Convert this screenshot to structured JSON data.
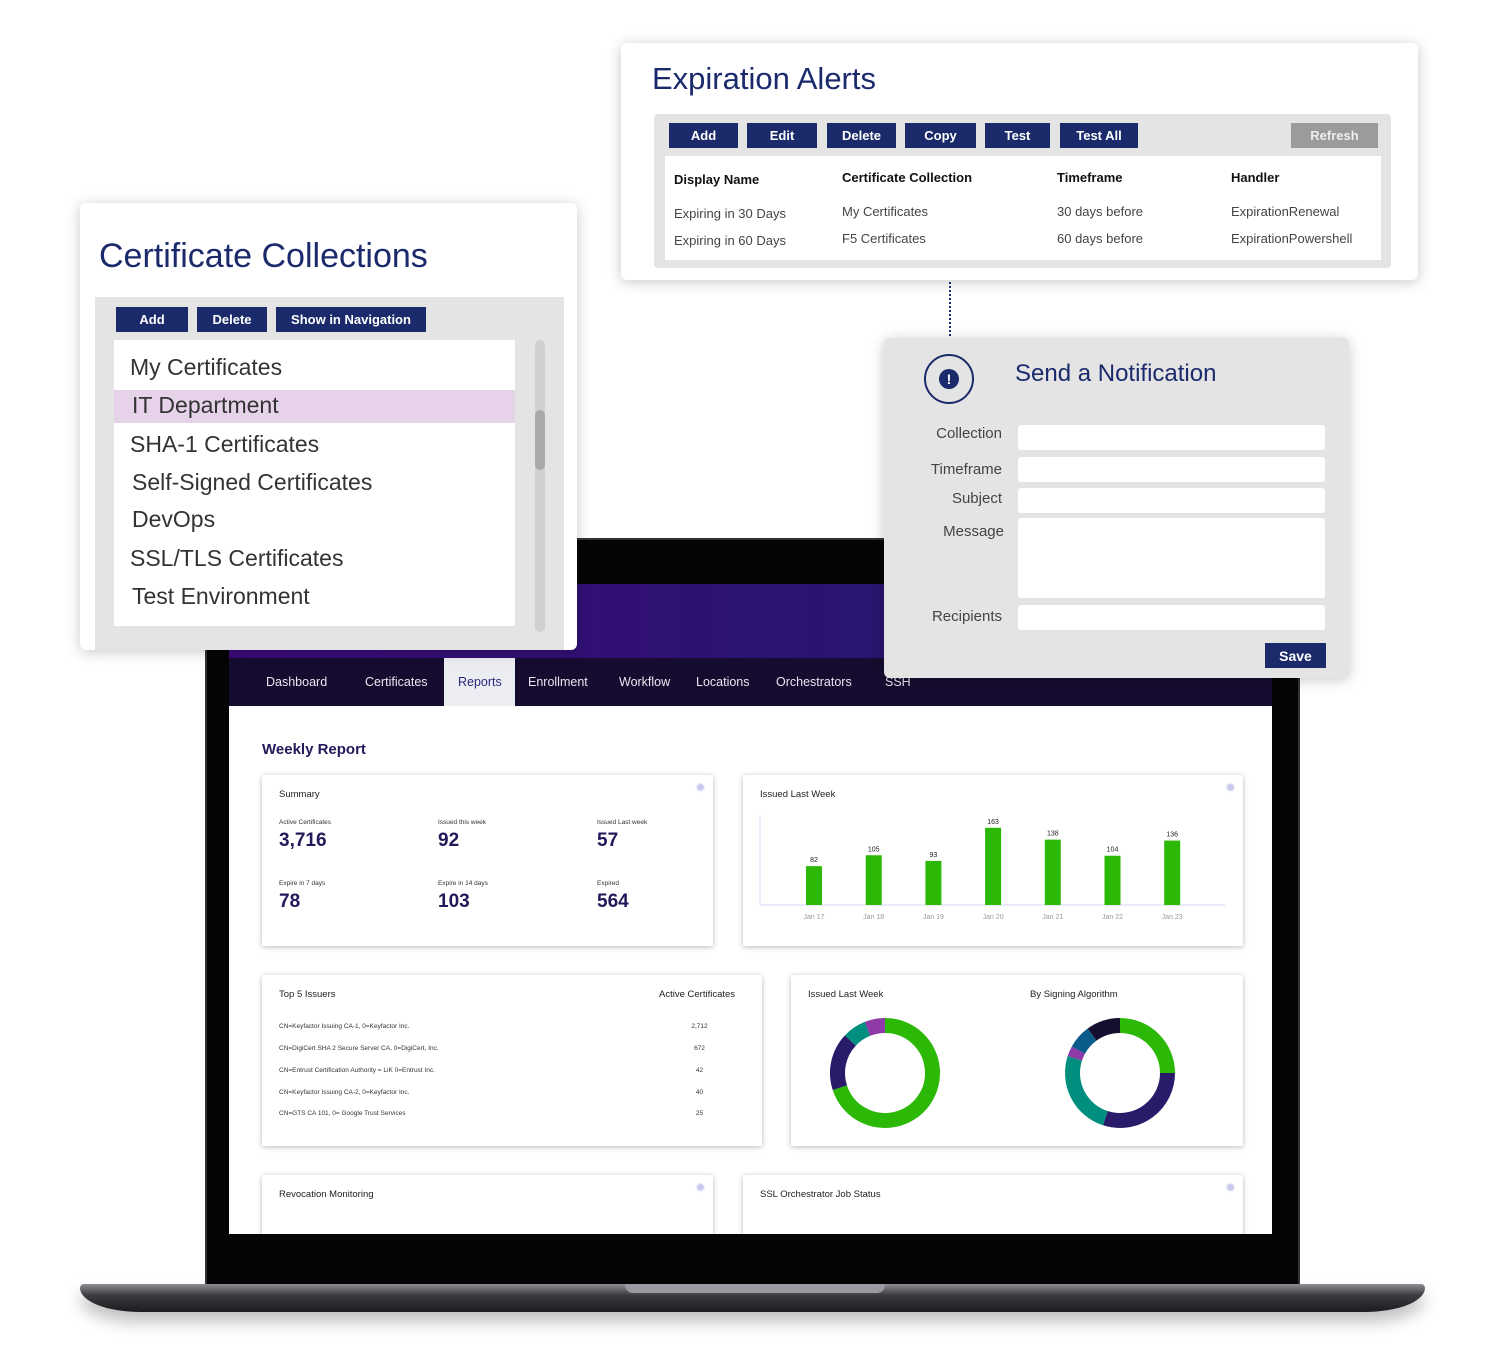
{
  "colors": {
    "navy": "#1b2a6b",
    "green": "#2bb806",
    "highlight": "#e6d3ea",
    "refresh": "#9b9b9b",
    "dark_purple": "#2a1a6a",
    "teal": "#008f7e",
    "magenta": "#8e3aa8",
    "blue": "#0a5c8a",
    "black": "#151030"
  },
  "collections": {
    "title": "Certificate Collections",
    "buttons": [
      "Add",
      "Delete",
      "Show in Navigation"
    ],
    "items": [
      "My Certificates",
      "IT Department",
      "SHA-1 Certificates",
      "Self-Signed Certificates",
      "DevOps",
      "SSL/TLS Certificates",
      "Test Environment"
    ],
    "selected": "IT Department"
  },
  "alerts": {
    "title": "Expiration Alerts",
    "buttons": [
      "Add",
      "Edit",
      "Delete",
      "Copy",
      "Test",
      "Test All"
    ],
    "refresh": "Refresh",
    "columns": [
      "Display Name",
      "Certificate Collection",
      "Timeframe",
      "Handler"
    ],
    "rows": [
      [
        "Expiring in 30 Days",
        "My Certificates",
        "30 days before",
        "ExpirationRenewal"
      ],
      [
        "Expiring in 60 Days",
        "F5 Certificates",
        "60 days before",
        "ExpirationPowershell"
      ]
    ]
  },
  "notification": {
    "icon": "alert-icon",
    "title": "Send a Notification",
    "fields": [
      "Collection",
      "Timeframe",
      "Subject",
      "Message",
      "Recipients"
    ],
    "save": "Save"
  },
  "nav": {
    "items": [
      "Dashboard",
      "Certificates",
      "Reports",
      "Enrollment",
      "Workflow",
      "Locations",
      "Orchestrators",
      "SSH"
    ],
    "active": "Reports"
  },
  "report": {
    "title": "Weekly Report",
    "summary": {
      "title": "Summary",
      "stats": [
        {
          "label": "Active Certificates",
          "value": "3,716"
        },
        {
          "label": "Issued this week",
          "value": "92"
        },
        {
          "label": "Issued Last week",
          "value": "57"
        },
        {
          "label": "Expire in 7 days",
          "value": "78"
        },
        {
          "label": "Expire in 14 days",
          "value": "103"
        },
        {
          "label": "Expired",
          "value": "564"
        }
      ]
    },
    "issuers": {
      "title": "Top 5 Issuers",
      "col": "Active Certificates",
      "rows": [
        {
          "name": "CN=Keyfactor Issuing CA-1, 0=Keyfactor Inc.",
          "count": "2,712"
        },
        {
          "name": "CN=DigiCert SHA 2 Secure Server CA, 0=DigiCert, Inc.",
          "count": "672"
        },
        {
          "name": "CN=Entrust Certification Authority = LiK 0=Entrust Inc.",
          "count": "42"
        },
        {
          "name": "CN=Keyfactor Issuing CA-2, 0=Keyfactor Inc.",
          "count": "40"
        },
        {
          "name": "CN=GTS CA 101, 0= Google Trust Services",
          "count": "25"
        }
      ]
    },
    "revocation_title": "Revocation Monitoring",
    "ssl_title": "SSL Orchestrator Job Status"
  },
  "chart_data": [
    {
      "type": "bar",
      "title": "Issued Last Week",
      "categories": [
        "Jan 17",
        "Jan 18",
        "Jan 19",
        "Jan 20",
        "Jan 21",
        "Jan 22",
        "Jan 23"
      ],
      "values": [
        82,
        105,
        93,
        163,
        138,
        104,
        136
      ],
      "ylim": [
        0,
        190
      ],
      "grid": false,
      "color": "#2bb806"
    },
    {
      "type": "pie",
      "title": "Issued Last Week",
      "donut": true,
      "values": [
        70,
        17,
        7,
        6
      ],
      "colors": [
        "#2bb806",
        "#2a1a6a",
        "#008f7e",
        "#8e3aa8"
      ]
    },
    {
      "type": "pie",
      "title": "By Signing Algorithm",
      "donut": true,
      "values": [
        25,
        30,
        25,
        3,
        7,
        10
      ],
      "colors": [
        "#2bb806",
        "#2a1a6a",
        "#008f7e",
        "#8e3aa8",
        "#0a5c8a",
        "#151030"
      ]
    }
  ]
}
